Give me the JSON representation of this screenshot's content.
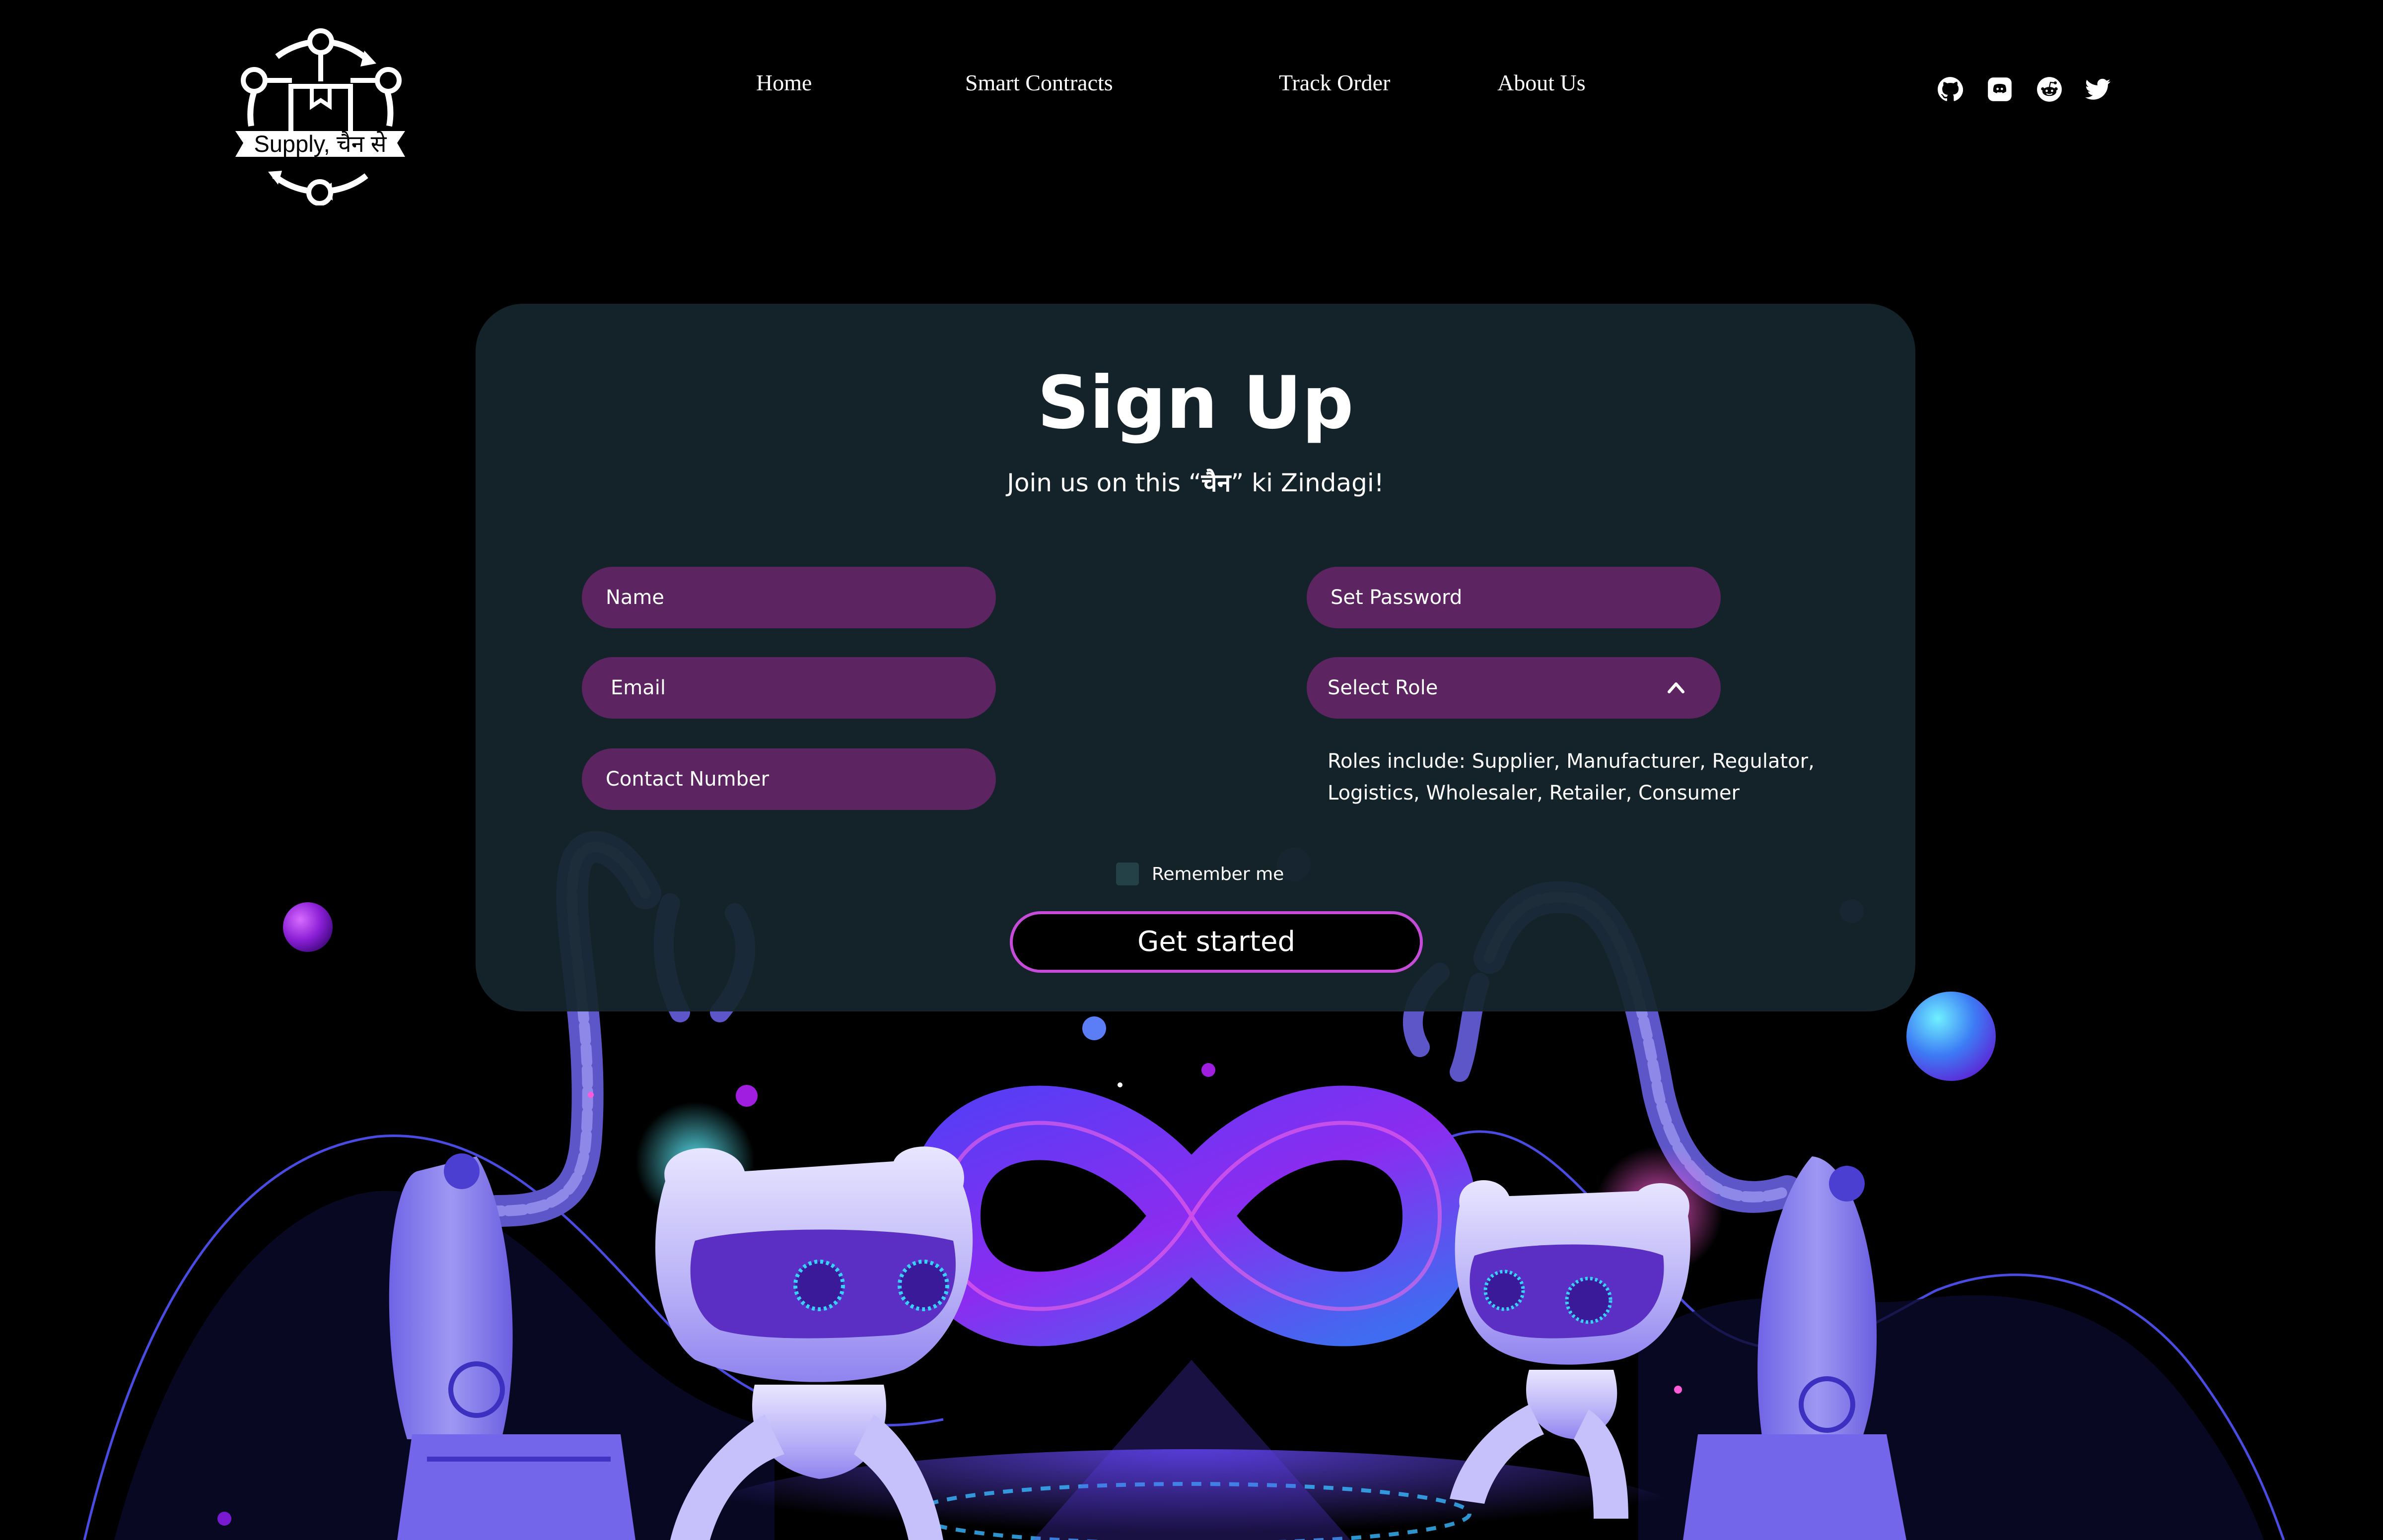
{
  "header": {
    "logo": {
      "text": "Supply, चैन से"
    },
    "nav": [
      {
        "label": "Home"
      },
      {
        "label": "Smart Contracts"
      },
      {
        "label": "Track Order"
      },
      {
        "label": "About Us"
      }
    ],
    "social_icons": [
      "github-icon",
      "discord-icon",
      "reddit-icon",
      "twitter-icon"
    ]
  },
  "signup": {
    "title": "Sign Up",
    "subtitle_prefix": "Join us on this “",
    "subtitle_bold": "चैन",
    "subtitle_suffix": "” ki Zindagi!",
    "fields": {
      "name_placeholder": "Name",
      "email_placeholder": "Email",
      "contact_placeholder": "Contact Number",
      "password_placeholder": "Set Password"
    },
    "role_select": {
      "selected": "Select Role",
      "icon": "chevron-up-icon"
    },
    "roles_note": "Roles include: Supplier, Manufacturer, Regulator, Logistics, Wholesaler, Retailer, Consumer",
    "remember_label": "Remember me",
    "remember_checked": false,
    "submit_label": "Get started"
  },
  "colors": {
    "background": "#000000",
    "card": "#15262c",
    "field": "#5c2460",
    "button_border": "#c64bd9",
    "text": "#ffffff"
  }
}
